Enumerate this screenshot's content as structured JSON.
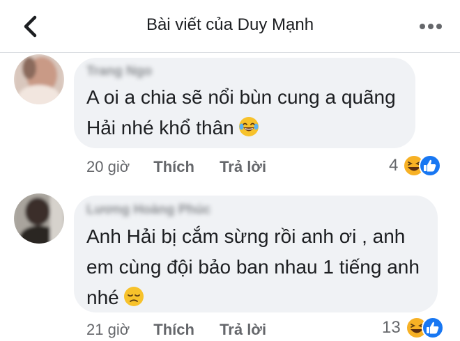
{
  "header": {
    "title": "Bài viết của Duy Mạnh",
    "back_icon": "chevron-left-icon",
    "more_icon": "more-horizontal-icon"
  },
  "comments": [
    {
      "author": "Trang Ngo",
      "text": "A oi a chia sẽ nổi bùn cung a quãng Hải nhé khổ thân",
      "emoji": "joy-emoji",
      "time": "20 giờ",
      "like_label": "Thích",
      "reply_label": "Trả lời",
      "reactions": {
        "count": "4",
        "icons": [
          "haha-reaction-icon",
          "like-reaction-icon"
        ]
      }
    },
    {
      "author": "Lương Hoàng Phúc",
      "text": "Anh Hải bị cắm sừng rồi anh ơi , anh em cùng đội bảo ban nhau 1 tiếng anh nhé",
      "emoji": "disappointed-emoji",
      "time": "21 giờ",
      "like_label": "Thích",
      "reply_label": "Trả lời",
      "reactions": {
        "count": "13",
        "icons": [
          "haha-reaction-icon",
          "like-reaction-icon"
        ]
      }
    }
  ],
  "colors": {
    "bubble": "#f0f2f5",
    "meta_text": "#65676b",
    "like_blue": "#1877f2",
    "haha_yellow": "#f7b125"
  }
}
